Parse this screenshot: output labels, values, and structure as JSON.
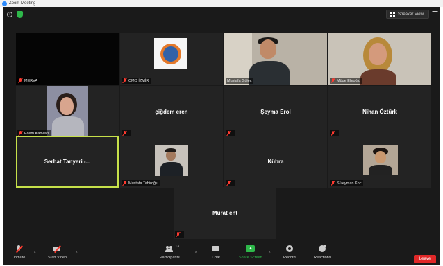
{
  "window": {
    "title": "Zoom Meeting"
  },
  "header": {
    "view_button": "Speaker View"
  },
  "participants": [
    {
      "name": "MERVA"
    },
    {
      "name": "ÇMO İZMİR"
    },
    {
      "name": "Mustafa Güleç"
    },
    {
      "name": "Müge Efeoğlu"
    },
    {
      "name": "Ecem Kahveci"
    },
    {
      "name": "çiğdem eren"
    },
    {
      "name": "Şeyma Erol"
    },
    {
      "name": "Nihan Öztürk"
    },
    {
      "name": "Serhat Tanyeri -..."
    },
    {
      "name": "Mustafa Tahiroğlu"
    },
    {
      "name": "Kübra"
    },
    {
      "name": "Süleyman Koc"
    },
    {
      "name": "Murat ent"
    }
  ],
  "toolbar": {
    "unmute": "Unmute",
    "start_video": "Start Video",
    "participants": "Participants",
    "participants_count": "13",
    "chat": "Chat",
    "share_screen": "Share Screen",
    "record": "Record",
    "reactions": "Reactions",
    "leave": "Leave"
  },
  "colors": {
    "active_speaker_border": "#c6e04a",
    "share_green": "#2eb84a",
    "leave_red": "#e02828",
    "muted_red": "#ff3b30"
  }
}
